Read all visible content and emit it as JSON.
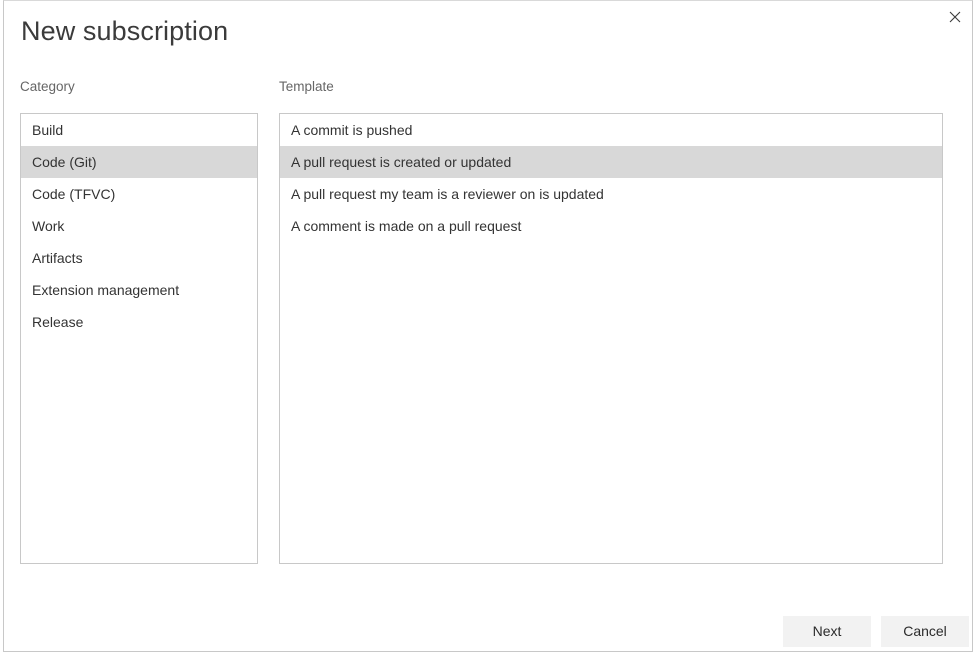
{
  "dialog": {
    "title": "New subscription",
    "close_icon": "close-icon"
  },
  "category_panel": {
    "label": "Category",
    "items": [
      {
        "label": "Build",
        "selected": false
      },
      {
        "label": "Code (Git)",
        "selected": true
      },
      {
        "label": "Code (TFVC)",
        "selected": false
      },
      {
        "label": "Work",
        "selected": false
      },
      {
        "label": "Artifacts",
        "selected": false
      },
      {
        "label": "Extension management",
        "selected": false
      },
      {
        "label": "Release",
        "selected": false
      }
    ]
  },
  "template_panel": {
    "label": "Template",
    "items": [
      {
        "label": "A commit is pushed",
        "selected": false
      },
      {
        "label": "A pull request is created or updated",
        "selected": true
      },
      {
        "label": "A pull request my team is a reviewer on is updated",
        "selected": false
      },
      {
        "label": "A comment is made on a pull request",
        "selected": false
      }
    ]
  },
  "footer": {
    "next_label": "Next",
    "cancel_label": "Cancel"
  },
  "colors": {
    "selection": "#d8d8d8",
    "border": "#c8c8c8",
    "button_bg": "#f2f2f2",
    "text": "#333333",
    "label_text": "#666666",
    "title_text": "#3b3b3b"
  }
}
